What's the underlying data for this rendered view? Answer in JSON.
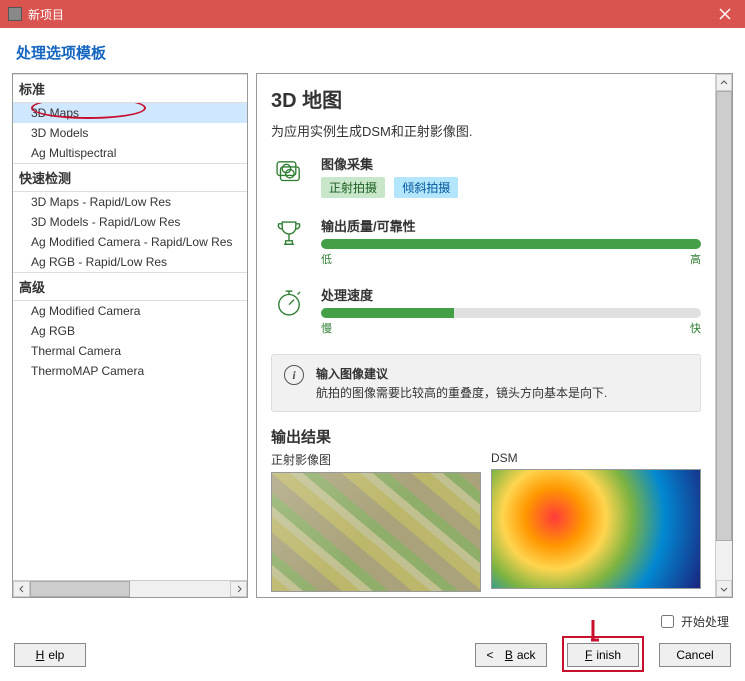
{
  "window": {
    "title": "新项目"
  },
  "subheader": "处理选项模板",
  "groups": {
    "g0": {
      "header": "标准",
      "items": [
        "3D Maps",
        "3D Models",
        "Ag Multispectral"
      ]
    },
    "g1": {
      "header": "快速检测",
      "items": [
        "3D Maps - Rapid/Low Res",
        "3D Models - Rapid/Low Res",
        "Ag Modified Camera - Rapid/Low Res",
        "Ag RGB - Rapid/Low Res"
      ]
    },
    "g2": {
      "header": "高级",
      "items": [
        "Ag Modified Camera",
        "Ag RGB",
        "Thermal Camera",
        "ThermoMAP Camera"
      ]
    }
  },
  "detail": {
    "title": "3D 地图",
    "subtitle": "为应用实例生成DSM和正射影像图.",
    "m0": {
      "label": "图像采集",
      "tag1": "正射拍摄",
      "tag2": "倾斜拍摄"
    },
    "m1": {
      "label": "输出质量/可靠性",
      "left": "低",
      "right": "高"
    },
    "m2": {
      "label": "处理速度",
      "left": "慢",
      "right": "快"
    },
    "info": {
      "title": "输入图像建议",
      "body": "航拍的图像需要比较高的重叠度，镜头方向基本是向下."
    },
    "outputs": {
      "title": "输出结果",
      "c0": "正射影像图",
      "c1": "DSM"
    }
  },
  "footer": {
    "checkbox": "开始处理"
  },
  "buttons": {
    "help": "Help",
    "back": "Back",
    "back_arrow": "<",
    "finish": "Finish",
    "cancel": "Cancel"
  }
}
